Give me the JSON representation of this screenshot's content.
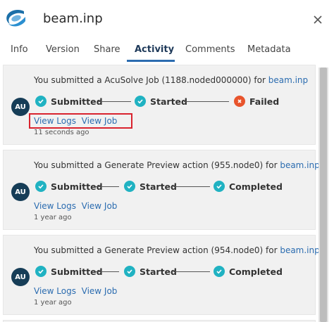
{
  "header": {
    "file_name": "beam.inp",
    "logo_icon": "app-logo-icon",
    "close_icon": "close-icon"
  },
  "tabs": [
    {
      "label": "Info",
      "active": false
    },
    {
      "label": "Version",
      "active": false
    },
    {
      "label": "Share",
      "active": false
    },
    {
      "label": "Activity",
      "active": true
    },
    {
      "label": "Comments",
      "active": false
    },
    {
      "label": "Metadata",
      "active": false
    }
  ],
  "activities": [
    {
      "message_prefix": "You submitted a AcuSolve Job (1188.noded000000) for ",
      "message_link": "beam.inp",
      "avatar": "AU",
      "steps": [
        {
          "label": "Submitted",
          "status": "done"
        },
        {
          "label": "Started",
          "status": "done"
        },
        {
          "label": "Failed",
          "status": "failed"
        }
      ],
      "view_logs": "View Logs",
      "view_job": "View Job",
      "time": "11 seconds ago"
    },
    {
      "message_prefix": "You submitted a Generate Preview action (955.node0) for ",
      "message_link": "beam.inp",
      "avatar": "AU",
      "steps": [
        {
          "label": "Submitted",
          "status": "done"
        },
        {
          "label": "Started",
          "status": "done"
        },
        {
          "label": "Completed",
          "status": "done"
        }
      ],
      "view_logs": "View Logs",
      "view_job": "View Job",
      "time": "1 year ago"
    },
    {
      "message_prefix": "You submitted a Generate Preview action (954.node0) for ",
      "message_link": "beam.inp",
      "avatar": "AU",
      "steps": [
        {
          "label": "Submitted",
          "status": "done"
        },
        {
          "label": "Started",
          "status": "done"
        },
        {
          "label": "Completed",
          "status": "done"
        }
      ],
      "view_logs": "View Logs",
      "view_job": "View Job",
      "time": "1 year ago"
    }
  ],
  "colors": {
    "accent": "#2b6cb0",
    "success": "#20b2c2",
    "failure": "#e8542c",
    "avatar": "#163d57",
    "highlight": "#d9232e"
  }
}
